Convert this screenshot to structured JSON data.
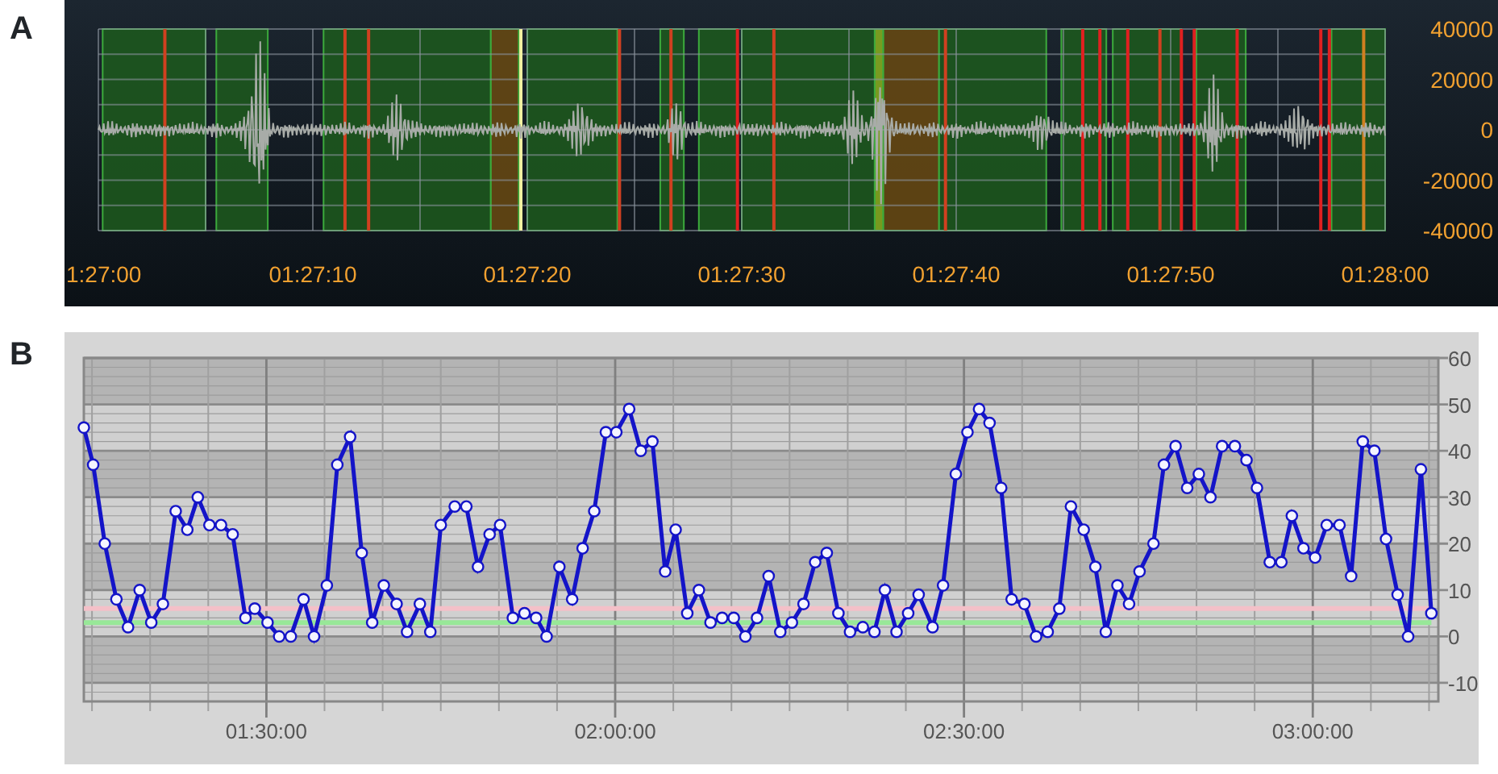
{
  "panel_a": {
    "label": "A",
    "y_ticks": [
      "40000",
      "20000",
      "0",
      "-20000",
      "-40000"
    ],
    "x_ticks": [
      "1:27:00",
      "01:27:10",
      "01:27:20",
      "01:27:30",
      "01:27:40",
      "01:27:50",
      "01:28:00"
    ]
  },
  "panel_b": {
    "label": "B",
    "chart_data": {
      "type": "line",
      "x": [
        74.3,
        75.1,
        76.1,
        77.1,
        78.1,
        79.1,
        80.1,
        81.1,
        82.2,
        83.2,
        84.1,
        85.1,
        86.1,
        87.1,
        88.2,
        89.0,
        90.1,
        91.1,
        92.1,
        93.2,
        94.1,
        95.2,
        96.1,
        97.2,
        98.2,
        99.1,
        100.1,
        101.2,
        102.1,
        103.2,
        104.1,
        105.0,
        106.2,
        107.2,
        108.2,
        109.2,
        110.1,
        111.2,
        112.2,
        113.2,
        114.1,
        115.2,
        116.3,
        117.2,
        118.2,
        119.2,
        120.1,
        121.2,
        122.2,
        123.2,
        124.3,
        125.2,
        126.2,
        127.2,
        128.2,
        129.2,
        130.2,
        131.2,
        132.2,
        133.2,
        134.2,
        135.2,
        136.2,
        137.2,
        138.2,
        139.2,
        140.2,
        141.3,
        142.3,
        143.2,
        144.2,
        145.2,
        146.1,
        147.3,
        148.2,
        149.3,
        150.3,
        151.3,
        152.2,
        153.2,
        154.1,
        155.2,
        156.2,
        157.2,
        158.2,
        159.2,
        160.3,
        161.3,
        162.2,
        163.2,
        164.2,
        165.1,
        166.3,
        167.2,
        168.2,
        169.2,
        170.2,
        171.2,
        172.2,
        173.3,
        174.3,
        175.2,
        176.3,
        177.3,
        178.2,
        179.2,
        180.2,
        181.2,
        182.3,
        183.3,
        184.3,
        185.3,
        186.3,
        187.3,
        188.2,
        189.3,
        190.2
      ],
      "series": [
        {
          "color": "#f4c0c8",
          "values": [
            6,
            6,
            6,
            6,
            6,
            6,
            6,
            6,
            6,
            6,
            6,
            6,
            6,
            6,
            6,
            6,
            6,
            6,
            6,
            6,
            6,
            6,
            6,
            6,
            6,
            6,
            6,
            6,
            6,
            6,
            6,
            6,
            6,
            6,
            6,
            6,
            6,
            6,
            6,
            6,
            6,
            6,
            6,
            6,
            6,
            6,
            6,
            6,
            6,
            6,
            6,
            6,
            6,
            6,
            6,
            6,
            6,
            6,
            6,
            6,
            6,
            6,
            6,
            6,
            6,
            6,
            6,
            6,
            6,
            6,
            6,
            6,
            6,
            6,
            6,
            6,
            6,
            6,
            6,
            6,
            6,
            6,
            6,
            6,
            6,
            6,
            6,
            6,
            6,
            6,
            6,
            6,
            6,
            6,
            6,
            6,
            6,
            6,
            6,
            6,
            6,
            6,
            6,
            6,
            6,
            6,
            6,
            6,
            6,
            6,
            6,
            6,
            6,
            6,
            6,
            6,
            6
          ]
        },
        {
          "color": "#98e898",
          "values": [
            3,
            3,
            3,
            3,
            3,
            3,
            3,
            3,
            3,
            3,
            3,
            3,
            3,
            3,
            3,
            3,
            3,
            3,
            3,
            3,
            3,
            3,
            3,
            3,
            3,
            3,
            3,
            3,
            3,
            3,
            3,
            3,
            3,
            3,
            3,
            3,
            3,
            3,
            3,
            3,
            3,
            3,
            3,
            3,
            3,
            3,
            3,
            3,
            3,
            3,
            3,
            3,
            3,
            3,
            3,
            3,
            3,
            3,
            3,
            3,
            3,
            3,
            3,
            3,
            3,
            3,
            3,
            3,
            3,
            3,
            3,
            3,
            3,
            3,
            3,
            3,
            3,
            3,
            3,
            3,
            3,
            3,
            3,
            3,
            3,
            3,
            3,
            3,
            3,
            3,
            3,
            3,
            3,
            3,
            3,
            3,
            3,
            3,
            3,
            3,
            3,
            3,
            3,
            3,
            3,
            3,
            3,
            3,
            3,
            3,
            3,
            3,
            3,
            3,
            3,
            3,
            3
          ]
        },
        {
          "color": "#1414c8",
          "marker": "o",
          "values": [
            45,
            37,
            20,
            8,
            2,
            10,
            3,
            7,
            27,
            23,
            30,
            24,
            24,
            22,
            4,
            6,
            3,
            0,
            0,
            8,
            0,
            11,
            37,
            43,
            18,
            3,
            11,
            7,
            1,
            7,
            1,
            24,
            28,
            28,
            15,
            22,
            24,
            4,
            5,
            4,
            0,
            15,
            8,
            19,
            27,
            44,
            44,
            49,
            40,
            42,
            14,
            23,
            5,
            10,
            3,
            4,
            4,
            0,
            4,
            13,
            1,
            3,
            7,
            16,
            18,
            5,
            1,
            2,
            1,
            10,
            1,
            5,
            9,
            2,
            11,
            35,
            44,
            49,
            46,
            32,
            8,
            7,
            0,
            1,
            6,
            28,
            23,
            15,
            1,
            11,
            7,
            14,
            20,
            37,
            41,
            32,
            35,
            30,
            41,
            41,
            38,
            32,
            16,
            16,
            26,
            19,
            17,
            24,
            24,
            13,
            42,
            40,
            21,
            9,
            0,
            36,
            5
          ]
        }
      ],
      "xlim": [
        74.3,
        190.8
      ],
      "ylim": [
        -14,
        60
      ],
      "xticks": [
        {
          "value": 90,
          "label": "01:30:00"
        },
        {
          "value": 120,
          "label": "02:00:00"
        },
        {
          "value": 150,
          "label": "02:30:00"
        },
        {
          "value": 180,
          "label": "03:00:00"
        }
      ],
      "yticks": [
        -10,
        0,
        10,
        20,
        30,
        40,
        50,
        60
      ],
      "grid": true
    }
  }
}
